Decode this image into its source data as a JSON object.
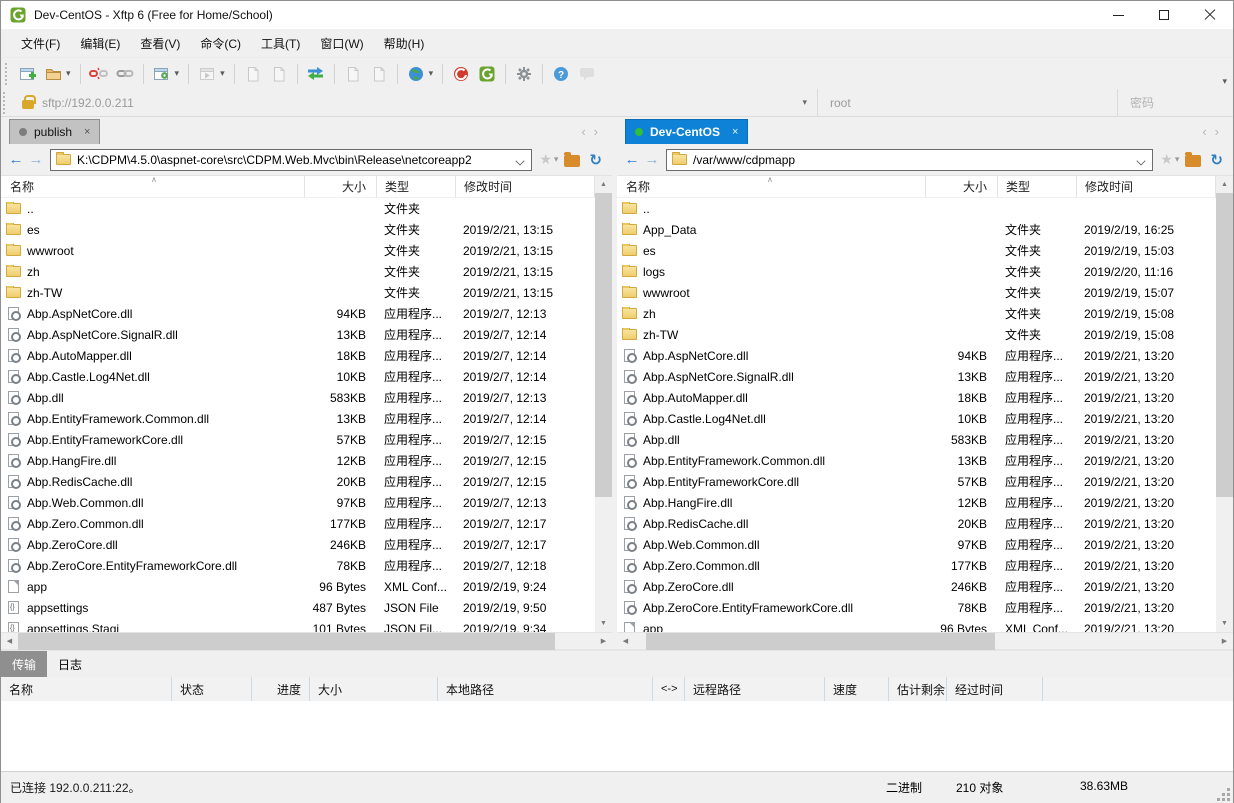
{
  "window": {
    "title": "Dev-CentOS - Xftp 6 (Free for Home/School)"
  },
  "menu": {
    "items": [
      "文件(F)",
      "编辑(E)",
      "查看(V)",
      "命令(C)",
      "工具(T)",
      "窗口(W)",
      "帮助(H)"
    ]
  },
  "toolbar": {
    "buttons": [
      {
        "icon": "new-session"
      },
      {
        "icon": "open-folder",
        "dropdown": true
      },
      {
        "sep": true
      },
      {
        "icon": "disconnect"
      },
      {
        "icon": "reconnect"
      },
      {
        "sep": true
      },
      {
        "icon": "session-properties",
        "dropdown": true
      },
      {
        "sep": true
      },
      {
        "icon": "run",
        "dropdown": true,
        "disabled": true
      },
      {
        "sep": true
      },
      {
        "icon": "upload",
        "disabled": true
      },
      {
        "icon": "download",
        "disabled": true
      },
      {
        "sep": true
      },
      {
        "icon": "transfer-mode"
      },
      {
        "sep": true
      },
      {
        "icon": "copy",
        "disabled": true
      },
      {
        "icon": "paste",
        "disabled": true
      },
      {
        "sep": true
      },
      {
        "icon": "web",
        "dropdown": true
      },
      {
        "sep": true
      },
      {
        "icon": "xshell"
      },
      {
        "icon": "xftp"
      },
      {
        "sep": true
      },
      {
        "icon": "settings"
      },
      {
        "sep": true
      },
      {
        "icon": "help"
      },
      {
        "icon": "feedback",
        "disabled": true
      }
    ]
  },
  "quick_connect": {
    "address": "sftp://192.0.0.211",
    "username": "root",
    "password_placeholder": "密码"
  },
  "left_panel": {
    "tab_label": "publish",
    "path": "K:\\CDPM\\4.5.0\\aspnet-core\\src\\CDPM.Web.Mvc\\bin\\Release\\netcoreapp2",
    "columns": {
      "name": "名称",
      "size": "大小",
      "type": "类型",
      "modified": "修改时间"
    },
    "rows": [
      {
        "icon": "folder",
        "name": "..",
        "size": "",
        "type": "文件夹",
        "modified": ""
      },
      {
        "icon": "folder",
        "name": "es",
        "size": "",
        "type": "文件夹",
        "modified": "2019/2/21, 13:15"
      },
      {
        "icon": "folder",
        "name": "wwwroot",
        "size": "",
        "type": "文件夹",
        "modified": "2019/2/21, 13:15"
      },
      {
        "icon": "folder",
        "name": "zh",
        "size": "",
        "type": "文件夹",
        "modified": "2019/2/21, 13:15"
      },
      {
        "icon": "folder",
        "name": "zh-TW",
        "size": "",
        "type": "文件夹",
        "modified": "2019/2/21, 13:15"
      },
      {
        "icon": "dll",
        "name": "Abp.AspNetCore.dll",
        "size": "94KB",
        "type": "应用程序...",
        "modified": "2019/2/7, 12:13"
      },
      {
        "icon": "dll",
        "name": "Abp.AspNetCore.SignalR.dll",
        "size": "13KB",
        "type": "应用程序...",
        "modified": "2019/2/7, 12:14"
      },
      {
        "icon": "dll",
        "name": "Abp.AutoMapper.dll",
        "size": "18KB",
        "type": "应用程序...",
        "modified": "2019/2/7, 12:14"
      },
      {
        "icon": "dll",
        "name": "Abp.Castle.Log4Net.dll",
        "size": "10KB",
        "type": "应用程序...",
        "modified": "2019/2/7, 12:14"
      },
      {
        "icon": "dll",
        "name": "Abp.dll",
        "size": "583KB",
        "type": "应用程序...",
        "modified": "2019/2/7, 12:13"
      },
      {
        "icon": "dll",
        "name": "Abp.EntityFramework.Common.dll",
        "size": "13KB",
        "type": "应用程序...",
        "modified": "2019/2/7, 12:14"
      },
      {
        "icon": "dll",
        "name": "Abp.EntityFrameworkCore.dll",
        "size": "57KB",
        "type": "应用程序...",
        "modified": "2019/2/7, 12:15"
      },
      {
        "icon": "dll",
        "name": "Abp.HangFire.dll",
        "size": "12KB",
        "type": "应用程序...",
        "modified": "2019/2/7, 12:15"
      },
      {
        "icon": "dll",
        "name": "Abp.RedisCache.dll",
        "size": "20KB",
        "type": "应用程序...",
        "modified": "2019/2/7, 12:15"
      },
      {
        "icon": "dll",
        "name": "Abp.Web.Common.dll",
        "size": "97KB",
        "type": "应用程序...",
        "modified": "2019/2/7, 12:13"
      },
      {
        "icon": "dll",
        "name": "Abp.Zero.Common.dll",
        "size": "177KB",
        "type": "应用程序...",
        "modified": "2019/2/7, 12:17"
      },
      {
        "icon": "dll",
        "name": "Abp.ZeroCore.dll",
        "size": "246KB",
        "type": "应用程序...",
        "modified": "2019/2/7, 12:17"
      },
      {
        "icon": "dll",
        "name": "Abp.ZeroCore.EntityFrameworkCore.dll",
        "size": "78KB",
        "type": "应用程序...",
        "modified": "2019/2/7, 12:18"
      },
      {
        "icon": "xml",
        "name": "app",
        "size": "96 Bytes",
        "type": "XML Conf...",
        "modified": "2019/2/19, 9:24"
      },
      {
        "icon": "json",
        "name": "appsettings",
        "size": "487 Bytes",
        "type": "JSON File",
        "modified": "2019/2/19, 9:50"
      },
      {
        "icon": "json",
        "name": "appsettings.Stagi",
        "size": "101 Bytes",
        "type": "JSON Fil...",
        "modified": "2019/2/19, 9:34"
      }
    ]
  },
  "right_panel": {
    "tab_label": "Dev-CentOS",
    "path": "/var/www/cdpmapp",
    "columns": {
      "name": "名称",
      "size": "大小",
      "type": "类型",
      "modified": "修改时间"
    },
    "rows": [
      {
        "icon": "folder",
        "name": "..",
        "size": "",
        "type": "",
        "modified": ""
      },
      {
        "icon": "folder",
        "name": "App_Data",
        "size": "",
        "type": "文件夹",
        "modified": "2019/2/19, 16:25"
      },
      {
        "icon": "folder",
        "name": "es",
        "size": "",
        "type": "文件夹",
        "modified": "2019/2/19, 15:03"
      },
      {
        "icon": "folder",
        "name": "logs",
        "size": "",
        "type": "文件夹",
        "modified": "2019/2/20, 11:16"
      },
      {
        "icon": "folder",
        "name": "wwwroot",
        "size": "",
        "type": "文件夹",
        "modified": "2019/2/19, 15:07"
      },
      {
        "icon": "folder",
        "name": "zh",
        "size": "",
        "type": "文件夹",
        "modified": "2019/2/19, 15:08"
      },
      {
        "icon": "folder",
        "name": "zh-TW",
        "size": "",
        "type": "文件夹",
        "modified": "2019/2/19, 15:08"
      },
      {
        "icon": "dll",
        "name": "Abp.AspNetCore.dll",
        "size": "94KB",
        "type": "应用程序...",
        "modified": "2019/2/21, 13:20"
      },
      {
        "icon": "dll",
        "name": "Abp.AspNetCore.SignalR.dll",
        "size": "13KB",
        "type": "应用程序...",
        "modified": "2019/2/21, 13:20"
      },
      {
        "icon": "dll",
        "name": "Abp.AutoMapper.dll",
        "size": "18KB",
        "type": "应用程序...",
        "modified": "2019/2/21, 13:20"
      },
      {
        "icon": "dll",
        "name": "Abp.Castle.Log4Net.dll",
        "size": "10KB",
        "type": "应用程序...",
        "modified": "2019/2/21, 13:20"
      },
      {
        "icon": "dll",
        "name": "Abp.dll",
        "size": "583KB",
        "type": "应用程序...",
        "modified": "2019/2/21, 13:20"
      },
      {
        "icon": "dll",
        "name": "Abp.EntityFramework.Common.dll",
        "size": "13KB",
        "type": "应用程序...",
        "modified": "2019/2/21, 13:20"
      },
      {
        "icon": "dll",
        "name": "Abp.EntityFrameworkCore.dll",
        "size": "57KB",
        "type": "应用程序...",
        "modified": "2019/2/21, 13:20"
      },
      {
        "icon": "dll",
        "name": "Abp.HangFire.dll",
        "size": "12KB",
        "type": "应用程序...",
        "modified": "2019/2/21, 13:20"
      },
      {
        "icon": "dll",
        "name": "Abp.RedisCache.dll",
        "size": "20KB",
        "type": "应用程序...",
        "modified": "2019/2/21, 13:20"
      },
      {
        "icon": "dll",
        "name": "Abp.Web.Common.dll",
        "size": "97KB",
        "type": "应用程序...",
        "modified": "2019/2/21, 13:20"
      },
      {
        "icon": "dll",
        "name": "Abp.Zero.Common.dll",
        "size": "177KB",
        "type": "应用程序...",
        "modified": "2019/2/21, 13:20"
      },
      {
        "icon": "dll",
        "name": "Abp.ZeroCore.dll",
        "size": "246KB",
        "type": "应用程序...",
        "modified": "2019/2/21, 13:20"
      },
      {
        "icon": "dll",
        "name": "Abp.ZeroCore.EntityFrameworkCore.dll",
        "size": "78KB",
        "type": "应用程序...",
        "modified": "2019/2/21, 13:20"
      },
      {
        "icon": "xml",
        "name": "app",
        "size": "96 Bytes",
        "type": "XML Conf...",
        "modified": "2019/2/21, 13:20"
      }
    ]
  },
  "transfer": {
    "tabs": [
      "传输",
      "日志"
    ],
    "columns": [
      "名称",
      "状态",
      "进度",
      "大小",
      "本地路径",
      "<->",
      "远程路径",
      "速度",
      "估计剩余...",
      "经过时间"
    ]
  },
  "status_bar": {
    "connection": "已连接 192.0.0.211:22。",
    "transfer_mode": "二进制",
    "object_count": "210 对象",
    "total_size": "38.63MB"
  },
  "colors": {
    "active_tab": "#0e82d6",
    "xftp_green": "#6aa32e",
    "folder_yellow": "#efcd6d"
  }
}
